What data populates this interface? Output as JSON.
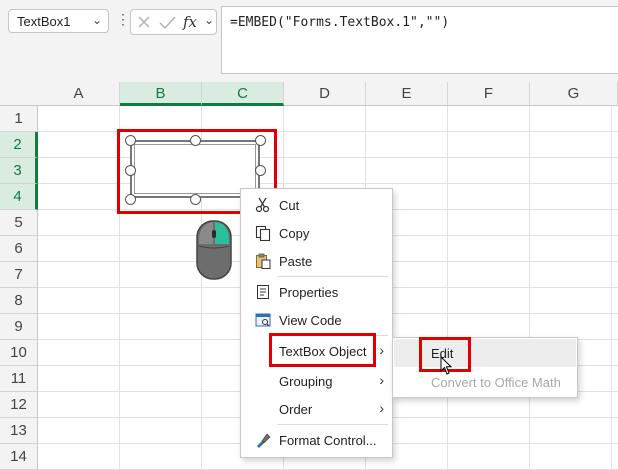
{
  "formula_bar": {
    "name_box": "TextBox1",
    "fx": "fx",
    "formula": "=EMBED(\"Forms.TextBox.1\",\"\")"
  },
  "columns": [
    "A",
    "B",
    "C",
    "D",
    "E",
    "F",
    "G"
  ],
  "rows": [
    "1",
    "2",
    "3",
    "4",
    "5",
    "6",
    "7",
    "8",
    "9",
    "10",
    "11",
    "12",
    "13",
    "14"
  ],
  "context_menu": {
    "items": [
      {
        "label": "Cut",
        "icon": "scissors-icon"
      },
      {
        "label": "Copy",
        "icon": "copy-icon"
      },
      {
        "label": "Paste",
        "icon": "paste-icon"
      },
      {
        "label": "Properties",
        "icon": "properties-icon"
      },
      {
        "label": "View Code",
        "icon": "view-code-icon"
      },
      {
        "label": "TextBox Object",
        "has_submenu": true
      },
      {
        "label": "Grouping",
        "has_submenu": true
      },
      {
        "label": "Order",
        "has_submenu": true
      },
      {
        "label": "Format Control...",
        "icon": "format-control-icon"
      }
    ]
  },
  "submenu": {
    "items": [
      {
        "label": "Edit",
        "enabled": true
      },
      {
        "label": "Convert to Office Math",
        "enabled": false
      }
    ]
  },
  "colors": {
    "highlight_red": "#e00000",
    "excel_green": "#107c41",
    "mouse_accent": "#2bbf9b"
  }
}
